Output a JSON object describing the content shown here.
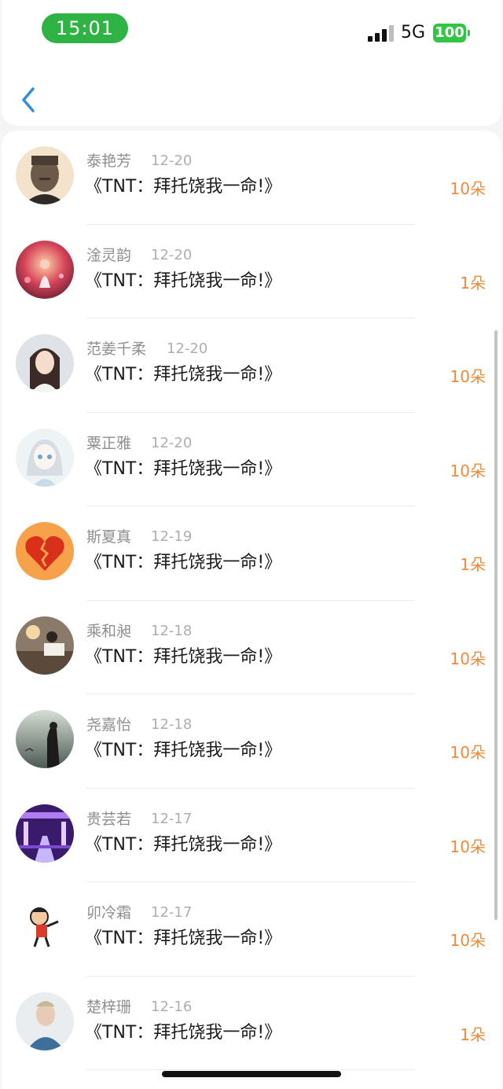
{
  "status_bar": {
    "time": "15:01",
    "network": "5G",
    "battery": "100"
  },
  "header": {
    "back_icon": "chevron-left-icon"
  },
  "list": [
    {
      "name": "泰艳芳",
      "date": "12-20",
      "title": "《TNT：拜托饶我一命!》",
      "count": "10朵",
      "avatar": "elderly-man-portrait"
    },
    {
      "name": "淦灵韵",
      "date": "12-20",
      "title": "《TNT：拜托饶我一命!》",
      "count": "1朵",
      "avatar": "fantasy-girl-red"
    },
    {
      "name": "范姜千柔",
      "date": "12-20",
      "title": "《TNT：拜托饶我一命!》",
      "count": "10朵",
      "avatar": "girl-portrait"
    },
    {
      "name": "粟正雅",
      "date": "12-20",
      "title": "《TNT：拜托饶我一命!》",
      "count": "10朵",
      "avatar": "anime-girl-sketch"
    },
    {
      "name": "斯夏真",
      "date": "12-19",
      "title": "《TNT：拜托饶我一命!》",
      "count": "1朵",
      "avatar": "broken-heart"
    },
    {
      "name": "乘和昶",
      "date": "12-18",
      "title": "《TNT：拜托饶我一命!》",
      "count": "10朵",
      "avatar": "girl-at-desk"
    },
    {
      "name": "尧嘉怡",
      "date": "12-18",
      "title": "《TNT：拜托饶我一命!》",
      "count": "10朵",
      "avatar": "woman-silhouette"
    },
    {
      "name": "贵芸若",
      "date": "12-17",
      "title": "《TNT：拜托饶我一命!》",
      "count": "10朵",
      "avatar": "purple-stage"
    },
    {
      "name": "卯冷霜",
      "date": "12-17",
      "title": "《TNT：拜托饶我一命!》",
      "count": "10朵",
      "avatar": "cartoon-character"
    },
    {
      "name": "楚梓珊",
      "date": "12-16",
      "title": "《TNT：拜托饶我一命!》",
      "count": "1朵",
      "avatar": "man-portrait"
    }
  ],
  "colors": {
    "accent_count": "#ee8a3a",
    "back_icon": "#2f8fd9",
    "time_pill": "#2fb344",
    "battery": "#32c546"
  }
}
